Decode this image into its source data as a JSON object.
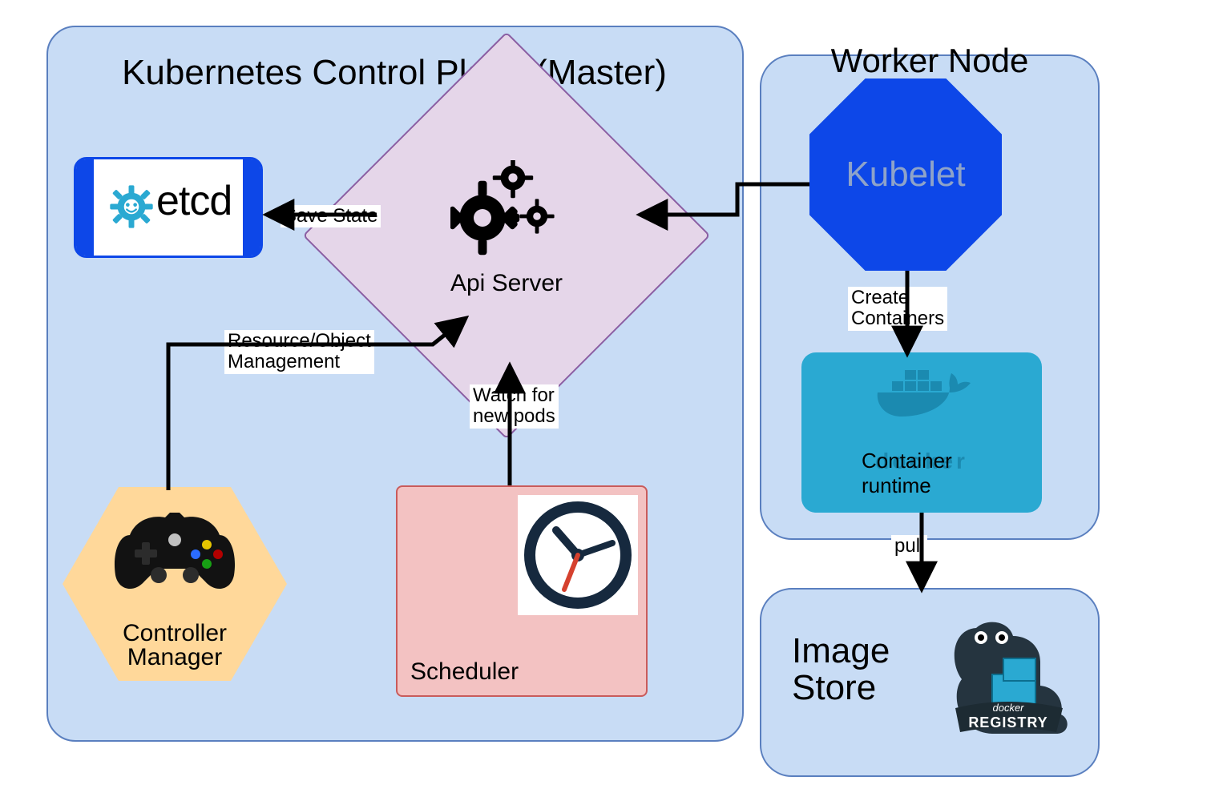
{
  "panels": {
    "control_plane_title": "Kubernetes Control Plane (Master)",
    "worker_title": "Worker Node",
    "image_store_title": "Image\nStore"
  },
  "nodes": {
    "etcd": {
      "text": "etcd"
    },
    "api_server": {
      "label": "Api Server"
    },
    "controller_manager": {
      "label": "Controller\nManager"
    },
    "scheduler": {
      "label": "Scheduler"
    },
    "kubelet": {
      "label": "Kubelet"
    },
    "container_runtime": {
      "label": "Container runtime",
      "docker_text": "docker"
    },
    "registry": {
      "label": "REGISTRY",
      "brand": "docker"
    }
  },
  "edges": {
    "save_state": "Save State",
    "resource_mgmt": "Resource/Object\nManagement",
    "watch_pods": "Watch for\nnew pods",
    "create_containers": "Create\nContainers",
    "pull": "pull"
  },
  "colors": {
    "panel_fill": "#c8dcf5",
    "panel_border": "#5a7fbf",
    "diamond_fill": "#e5d6e9",
    "diamond_border": "#8b5fa3",
    "hex_fill": "#ffd89a",
    "hex_border": "#c78a1f",
    "scheduler_fill": "#f3c2c2",
    "scheduler_border": "#c95b5b",
    "kubelet_fill": "#0d47e8",
    "runtime_fill": "#2aa9d2",
    "etcd_accent": "#0d47e8",
    "etcd_gear": "#2aa9d2"
  }
}
